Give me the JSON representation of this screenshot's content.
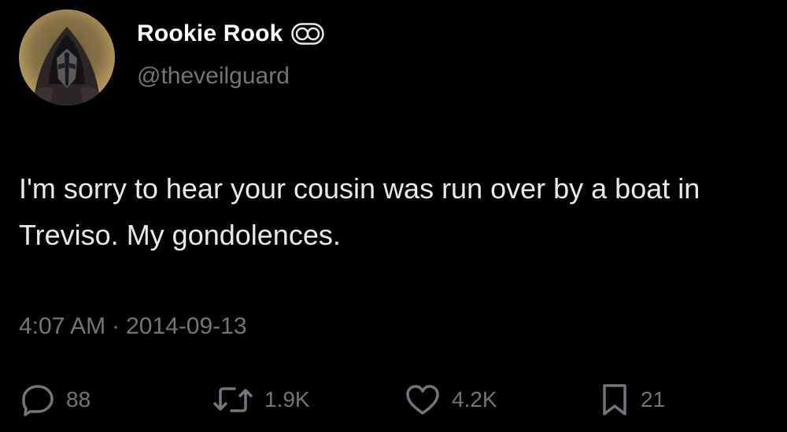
{
  "author": {
    "display_name": "Rookie Rook",
    "handle": "@theveilguard",
    "avatar_icon": "hooded-knight-avatar",
    "badge_icon": "infinity-badge-icon"
  },
  "tweet": {
    "text": "I'm sorry to hear your cousin was run over by a boat in Treviso. My gondolences.",
    "time": "4:07 AM",
    "separator": "·",
    "date": "2014-09-13"
  },
  "actions": {
    "reply_count": "88",
    "retweet_count": "1.9K",
    "like_count": "4.2K",
    "bookmark_count": "21"
  },
  "colors": {
    "background": "#000000",
    "primary_text": "#e7e9ea",
    "secondary_text": "#71767b"
  }
}
